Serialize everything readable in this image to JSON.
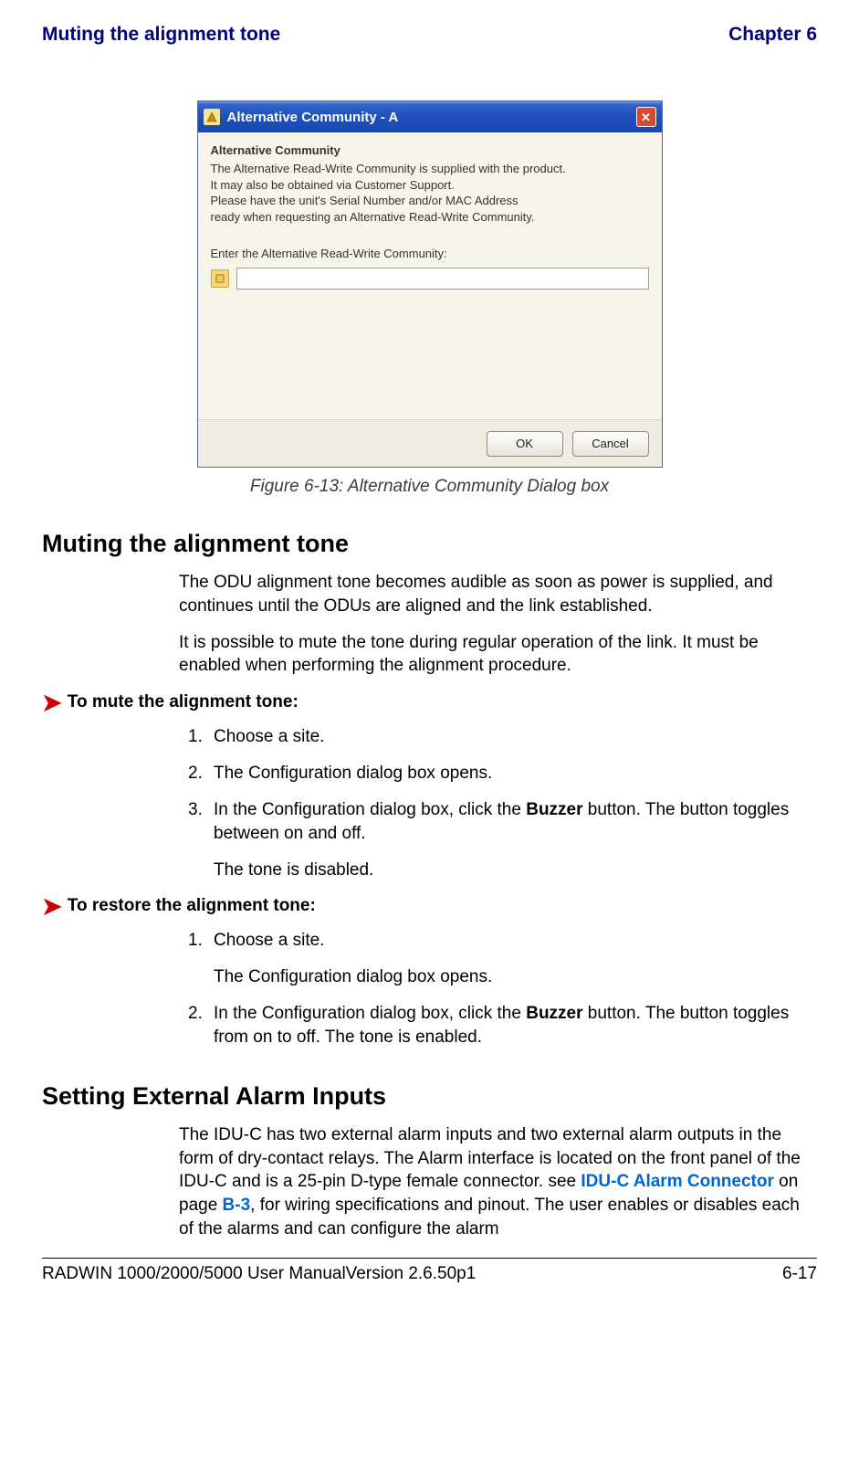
{
  "header": {
    "left": "Muting the alignment tone",
    "right": "Chapter 6"
  },
  "dialog": {
    "title": "Alternative Community - A",
    "legend": "Alternative Community",
    "help_line1": "The Alternative Read-Write Community is supplied with the product.",
    "help_line2": "It may also be obtained via Customer Support.",
    "help_line3": "Please have the unit's Serial Number and/or MAC Address",
    "help_line4": "ready when requesting an Alternative Read-Write Community.",
    "input_label": "Enter the Alternative Read-Write Community:",
    "input_value": "",
    "ok_label": "OK",
    "cancel_label": "Cancel"
  },
  "figure_caption": "Figure 6-13: Alternative Community Dialog box",
  "section_muting": {
    "heading": "Muting the alignment tone",
    "para1": "The ODU alignment tone becomes audible as soon as power is supplied, and continues until the ODUs are aligned and the link established.",
    "para2": "It is possible to mute the tone during regular operation of the link. It must be enabled when performing the alignment procedure.",
    "mute_proc_head": "To mute the alignment tone:",
    "mute_steps": {
      "s1": "Choose a site.",
      "s2": "The Configuration dialog box opens.",
      "s3_pre": "In the Configuration dialog box, click the ",
      "s3_bold": "Buzzer",
      "s3_post": " button. The button toggles between on and off.",
      "s3_sub": "The tone is disabled."
    },
    "restore_proc_head": "To restore the alignment tone:",
    "restore_steps": {
      "s1": "Choose a site.",
      "s1_sub": "The Configuration dialog box opens.",
      "s2_pre": "In the Configuration dialog box, click the ",
      "s2_bold": "Buzzer",
      "s2_post": " button. The button toggles from on to off. The tone is enabled."
    }
  },
  "section_alarm": {
    "heading": "Setting External Alarm Inputs",
    "para_pre": "The IDU-C has two external alarm inputs and two external alarm outputs in the form of dry-contact relays. The Alarm interface is located on the front panel of the IDU-C and is a 25-pin D-type female connector. see ",
    "link_text": "IDU-C Alarm Connector",
    "para_mid": " on page ",
    "page_ref": "B-3",
    "para_post": ", for wiring specifications and pinout. The user enables or disables each of the alarms and can configure the alarm"
  },
  "footer": {
    "left": "RADWIN 1000/2000/5000 User ManualVersion  2.6.50p1",
    "right": "6-17"
  }
}
